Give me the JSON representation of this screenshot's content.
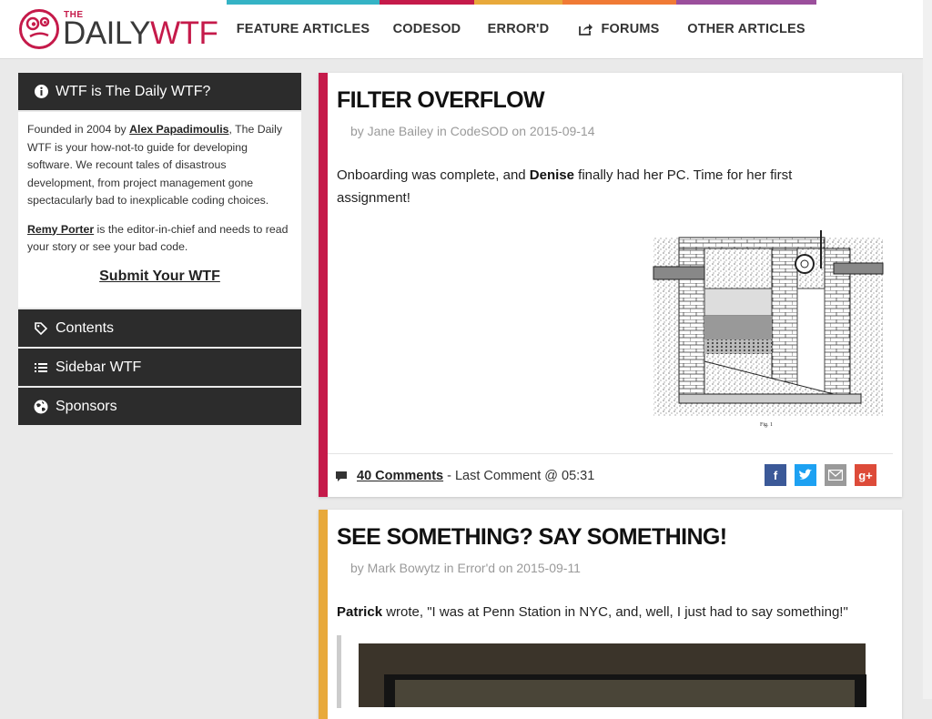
{
  "site": {
    "the": "THE",
    "daily": "DAILY",
    "wtf": "WTF"
  },
  "nav": {
    "items": [
      {
        "label": "FEATURE ARTICLES",
        "color": "#35b3c5"
      },
      {
        "label": "CODESOD",
        "color": "#c51a4a"
      },
      {
        "label": "ERROR'D",
        "color": "#e8a93b"
      },
      {
        "label": "FORUMS",
        "color": "#f07a35",
        "icon": "share-icon"
      },
      {
        "label": "OTHER ARTICLES",
        "color": "#9b4f9c"
      }
    ]
  },
  "sidebar": {
    "about_title": "WTF is The Daily WTF?",
    "about_p1_prefix": "Founded in 2004 by ",
    "about_p1_author": "Alex Papadimoulis",
    "about_p1_suffix": ", The Daily WTF is your how-not-to guide for developing software. We recount tales of disastrous development, from project management gone spectacularly bad to inexplicable coding choices.",
    "about_p2_editor": "Remy Porter",
    "about_p2_suffix": " is the editor-in-chief and needs to read your story or see your bad code.",
    "submit_label": "Submit Your WTF",
    "sections": [
      {
        "label": "Contents",
        "icon": "tags-icon"
      },
      {
        "label": "Sidebar WTF",
        "icon": "list-icon"
      },
      {
        "label": "Sponsors",
        "icon": "globe-icon"
      }
    ]
  },
  "articles": [
    {
      "title": "FILTER OVERFLOW",
      "byline": "by Jane Bailey in CodeSOD on 2015-09-14",
      "body_pre": "Onboarding was complete, and ",
      "body_bold": "Denise",
      "body_post": " finally had her PC. Time for her first assignment!",
      "image_caption": "Fig. 1",
      "comments": "40 Comments",
      "last_comment": "- Last Comment @ 05:31",
      "accent": "#c51a4a"
    },
    {
      "title": "SEE SOMETHING? SAY SOMETHING!",
      "byline": "by Mark Bowytz in Error'd on 2015-09-11",
      "body_bold": "Patrick",
      "body_post": " wrote, \"I was at Penn Station in NYC, and, well, I just had to say something!\"",
      "accent": "#e8a93b"
    }
  ],
  "share": [
    {
      "icon": "facebook-icon",
      "glyph": "f",
      "color": "#3b5998"
    },
    {
      "icon": "twitter-icon",
      "glyph": "t",
      "color": "#1da1f2"
    },
    {
      "icon": "email-icon",
      "glyph": "",
      "color": "#9a9a9a"
    },
    {
      "icon": "google-plus-icon",
      "glyph": "g+",
      "color": "#dd4b39"
    }
  ]
}
